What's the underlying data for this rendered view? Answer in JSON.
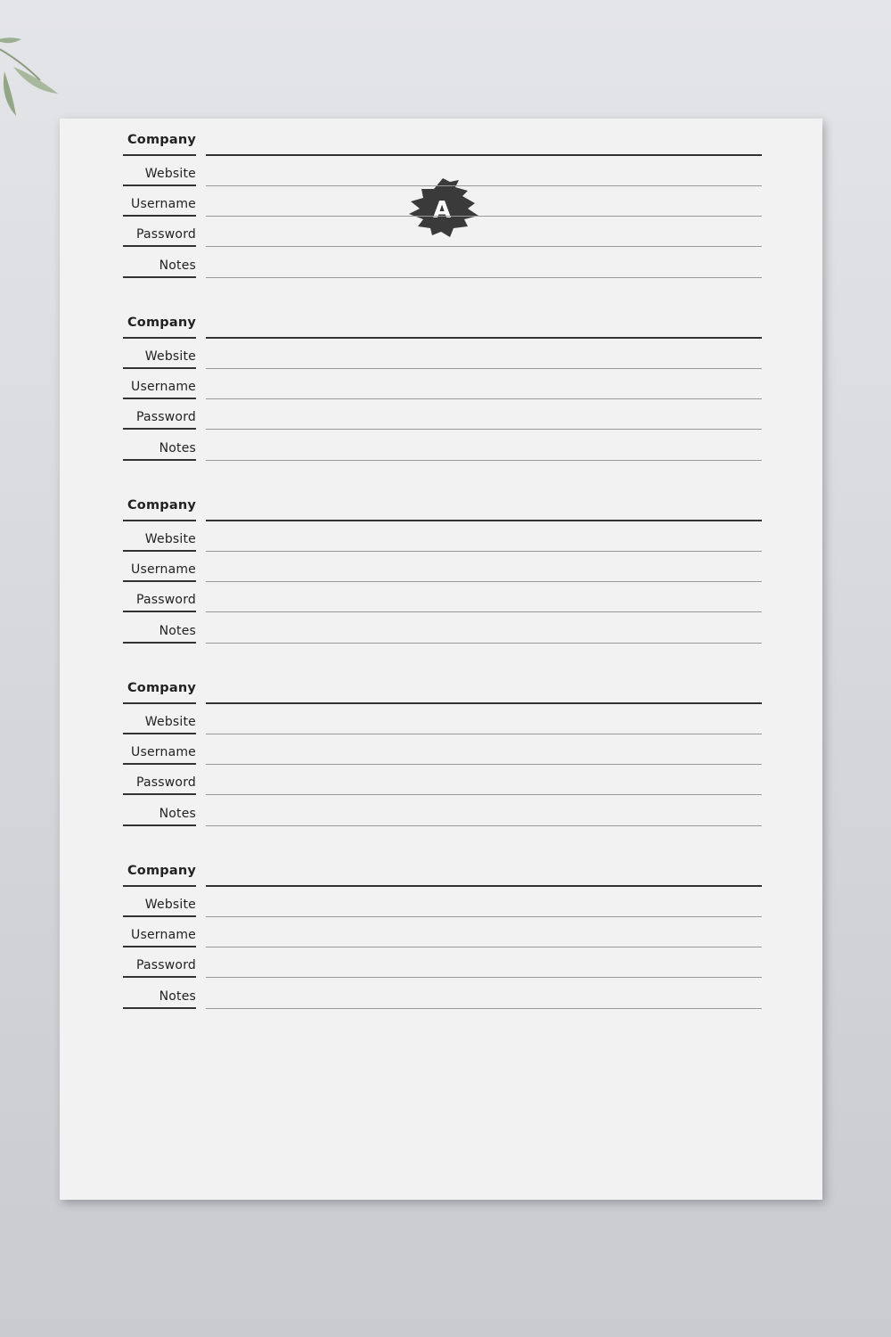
{
  "document": {
    "logo_letter": "A",
    "accent_color": "#3a3a3a",
    "entry_fields": [
      "Company",
      "Website",
      "Username",
      "Password",
      "Notes"
    ],
    "entries": [
      {
        "company": "Company",
        "website": "Website",
        "username": "Username",
        "password": "Password",
        "notes": "Notes"
      },
      {
        "company": "Company",
        "website": "Website",
        "username": "Username",
        "password": "Password",
        "notes": "Notes"
      },
      {
        "company": "Company",
        "website": "Website",
        "username": "Username",
        "password": "Password",
        "notes": "Notes"
      },
      {
        "company": "Company",
        "website": "Website",
        "username": "Username",
        "password": "Password",
        "notes": "Notes"
      },
      {
        "company": "Company",
        "website": "Website",
        "username": "Username",
        "password": "Password",
        "notes": "Notes"
      }
    ]
  }
}
